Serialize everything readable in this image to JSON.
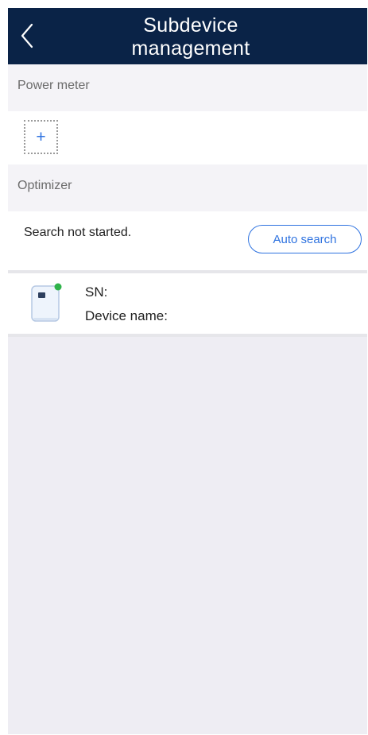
{
  "header": {
    "title": "Subdevice management",
    "bg_color": "#0a2347"
  },
  "sections": {
    "power_meter": {
      "label": "Power meter",
      "add_symbol": "+"
    },
    "optimizer": {
      "label": "Optimizer",
      "status": "Search not started.",
      "auto_search_label": "Auto search"
    }
  },
  "device": {
    "sn_label": "SN:",
    "name_label": "Device name:",
    "status_color": "#2fb34a"
  },
  "colors": {
    "accent": "#2f73e0",
    "screen_bg": "#eeedf3"
  },
  "icons": {
    "back": "chevron-left-icon",
    "add": "plus-icon",
    "device": "inverter-device-icon"
  }
}
